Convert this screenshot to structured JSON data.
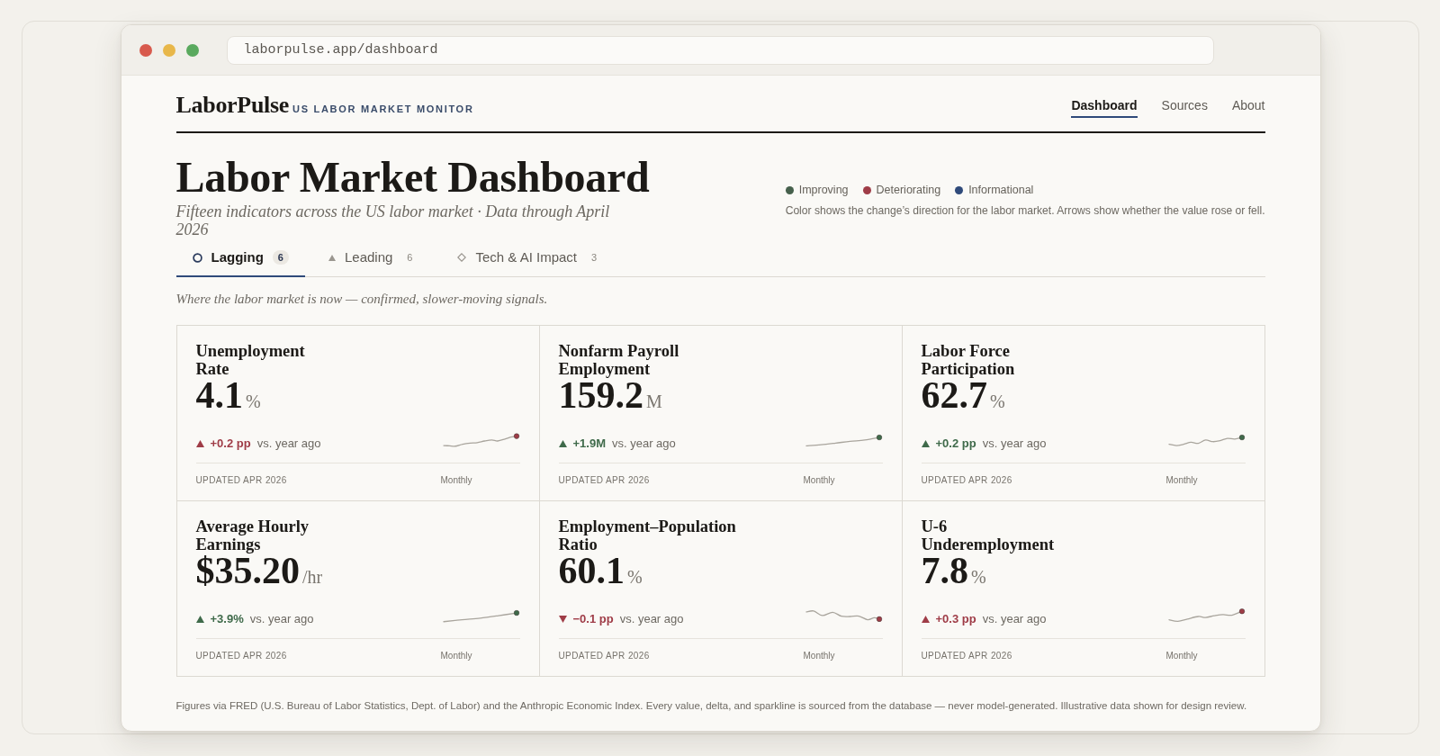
{
  "browser": {
    "url": "laborpulse.app/dashboard"
  },
  "header": {
    "logo": "LaborPulse",
    "tagline": "US LABOR MARKET MONITOR",
    "nav": [
      {
        "label": "Dashboard",
        "selected": true
      },
      {
        "label": "Sources",
        "selected": false
      },
      {
        "label": "About",
        "selected": false
      }
    ]
  },
  "hero": {
    "title": "Labor Market Dashboard",
    "subtitle": "Fifteen indicators across the US labor market · Data through April 2026"
  },
  "legend": {
    "items": [
      {
        "label": "Improving",
        "color": "#46604c"
      },
      {
        "label": "Deteriorating",
        "color": "#9f3c47"
      },
      {
        "label": "Informational",
        "color": "#2f4a7a"
      }
    ],
    "note": "Color shows the change’s direction for the labor market. Arrows show whether the value rose or fell."
  },
  "tabs": [
    {
      "label": "Lagging",
      "count": "6",
      "selected": true
    },
    {
      "label": "Leading",
      "count": "6",
      "selected": false
    },
    {
      "label": "Tech & AI Impact",
      "count": "3",
      "selected": false
    }
  ],
  "tab_description": "Where the labor market is now — confirmed, slower-moving signals.",
  "cards": [
    {
      "title": "Unemployment Rate",
      "value": "4.1",
      "unit": "%",
      "rising": true,
      "color": "#9f3c47",
      "delta": "+0.2 pp",
      "comparison": "vs. year ago",
      "updated": "UPDATED APR 2026",
      "frequency": "Monthly"
    },
    {
      "title": "Nonfarm Payroll Employment",
      "value": "159.2",
      "unit": "M",
      "rising": true,
      "color": "#3f6a4a",
      "delta": "+1.9M",
      "comparison": "vs. year ago",
      "updated": "UPDATED APR 2026",
      "frequency": "Monthly"
    },
    {
      "title": "Labor Force Participation",
      "value": "62.7",
      "unit": "%",
      "rising": true,
      "color": "#3f6a4a",
      "delta": "+0.2 pp",
      "comparison": "vs. year ago",
      "updated": "UPDATED APR 2026",
      "frequency": "Monthly"
    },
    {
      "title": "Average Hourly Earnings",
      "value": "$35.20",
      "unit": "/hr",
      "rising": true,
      "color": "#3f6a4a",
      "delta": "+3.9%",
      "comparison": "vs. year ago",
      "updated": "UPDATED APR 2026",
      "frequency": "Monthly"
    },
    {
      "title": "Employment–Population Ratio",
      "value": "60.1",
      "unit": "%",
      "rising": false,
      "color": "#9f3c47",
      "delta": "−0.1 pp",
      "comparison": "vs. year ago",
      "updated": "UPDATED APR 2026",
      "frequency": "Monthly"
    },
    {
      "title": "U-6 Underemployment",
      "value": "7.8",
      "unit": "%",
      "rising": true,
      "color": "#9f3c47",
      "delta": "+0.3 pp",
      "comparison": "vs. year ago",
      "updated": "UPDATED APR 2026",
      "frequency": "Monthly"
    }
  ],
  "footnote": "Figures via FRED (U.S. Bureau of Labor Statistics, Dept. of Labor) and the Anthropic Economic Index. Every value, delta, and sparkline is sourced from the database — never model-generated. Illustrative data shown for design review."
}
